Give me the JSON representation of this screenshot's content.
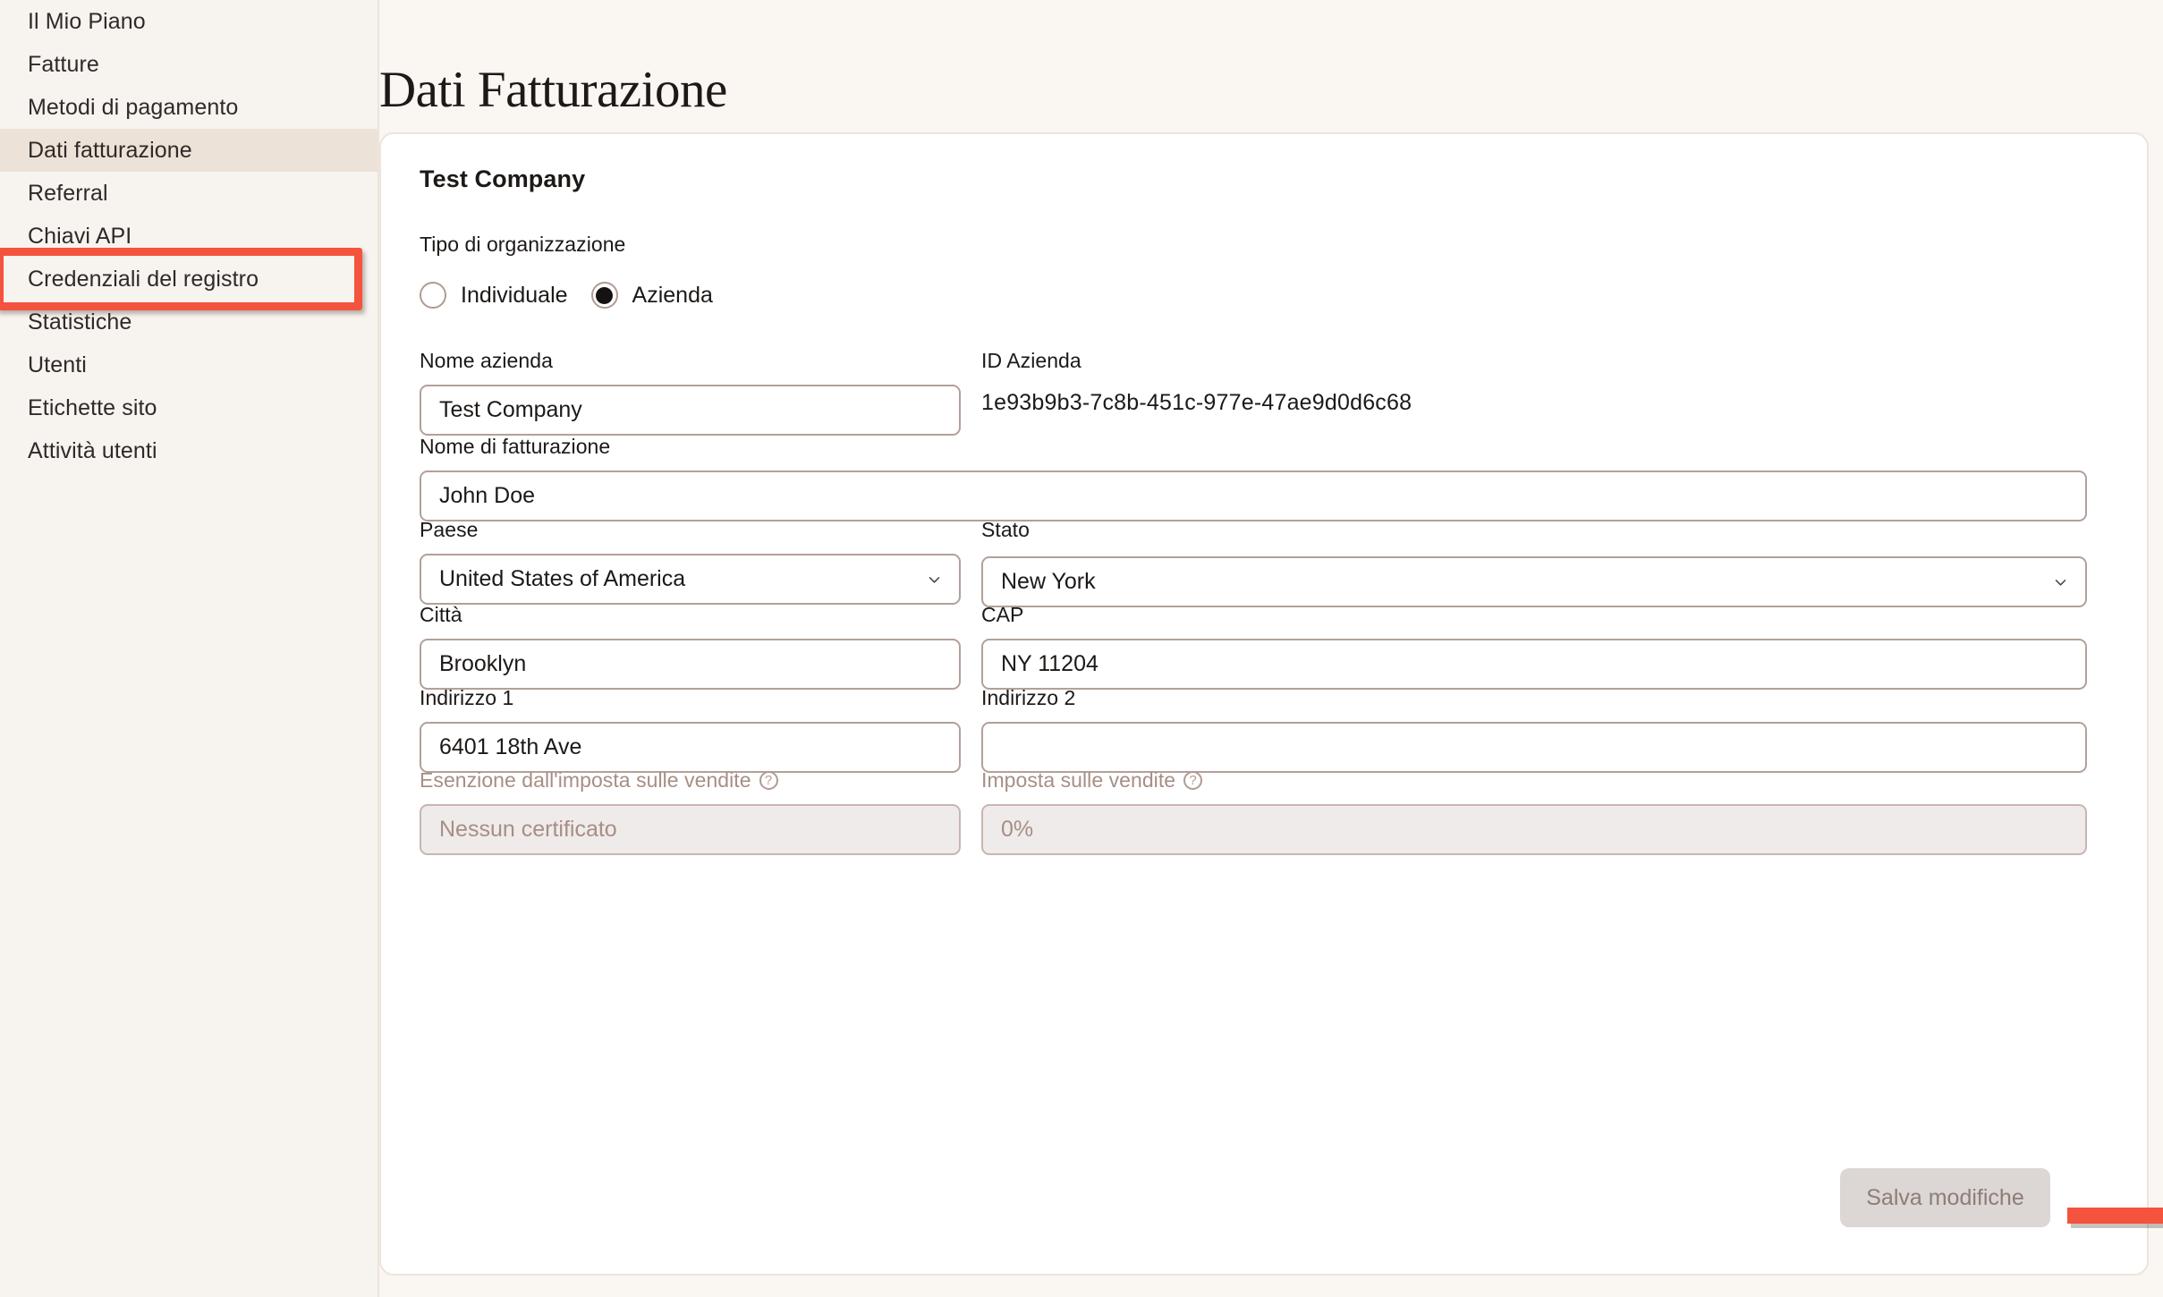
{
  "sidebar": {
    "items": [
      {
        "label": "Il Mio Piano",
        "name": "sidebar-item-il-mio-piano"
      },
      {
        "label": "Fatture",
        "name": "sidebar-item-fatture"
      },
      {
        "label": "Metodi di pagamento",
        "name": "sidebar-item-metodi-di-pagamento"
      },
      {
        "label": "Dati fatturazione",
        "name": "sidebar-item-dati-fatturazione",
        "active": true
      },
      {
        "label": "Referral",
        "name": "sidebar-item-referral"
      },
      {
        "label": "Chiavi API",
        "name": "sidebar-item-chiavi-api"
      },
      {
        "label": "Credenziali del registro",
        "name": "sidebar-item-credenziali-del-registro"
      },
      {
        "label": "Statistiche",
        "name": "sidebar-item-statistiche"
      },
      {
        "label": "Utenti",
        "name": "sidebar-item-utenti"
      },
      {
        "label": "Etichette sito",
        "name": "sidebar-item-etichette-sito"
      },
      {
        "label": "Attività utenti",
        "name": "sidebar-item-attivita-utenti"
      }
    ]
  },
  "header": {
    "title": "Dati Fatturazione"
  },
  "card": {
    "company_heading": "Test Company",
    "org_type": {
      "label": "Tipo di organizzazione",
      "options": [
        {
          "label": "Individuale",
          "selected": false
        },
        {
          "label": "Azienda",
          "selected": true
        }
      ]
    },
    "fields": {
      "company_name": {
        "label": "Nome azienda",
        "value": "Test Company",
        "placeholder": ""
      },
      "company_id": {
        "label": "ID Azienda",
        "value": "1e93b9b3-7c8b-451c-977e-47ae9d0d6c68"
      },
      "billing_name": {
        "label": "Nome di fatturazione",
        "value": "John Doe",
        "placeholder": ""
      },
      "country": {
        "label": "Paese",
        "value": "United States of America"
      },
      "state": {
        "label": "Stato",
        "value": "New York"
      },
      "city": {
        "label": "Città",
        "value": "Brooklyn",
        "placeholder": ""
      },
      "zip": {
        "label": "CAP",
        "value": "NY 11204",
        "placeholder": ""
      },
      "address1": {
        "label": "Indirizzo 1",
        "value": "6401 18th Ave",
        "placeholder": ""
      },
      "address2": {
        "label": "Indirizzo 2",
        "value": "",
        "placeholder": ""
      },
      "tax_exemption": {
        "label": "Esenzione dall'imposta sulle vendite",
        "value": "Nessun certificato",
        "help": "?"
      },
      "sales_tax": {
        "label": "Imposta sulle vendite",
        "value": "0%",
        "help": "?"
      }
    },
    "save_label": "Salva modifiche"
  },
  "annotations": {
    "highlight_color": "#F4533E",
    "arrow_color": "#F4533E"
  }
}
